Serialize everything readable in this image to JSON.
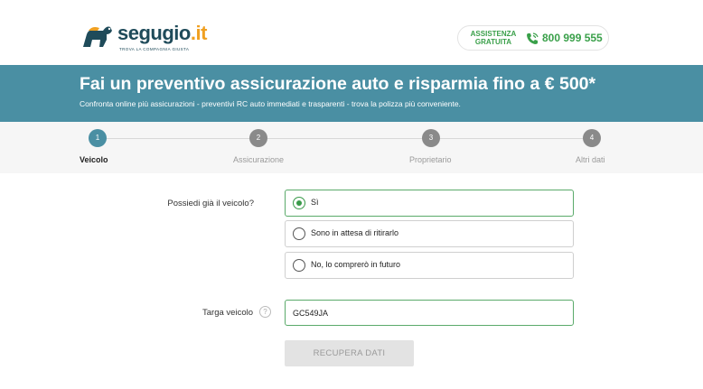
{
  "header": {
    "logo_name": "segugio",
    "logo_tld": ".it",
    "logo_tagline": "TROVA LA COMPAGNIA GIUSTA",
    "assist_line1": "ASSISTENZA",
    "assist_line2": "GRATUITA",
    "phone": "800 999 555"
  },
  "banner": {
    "title": "Fai un preventivo assicurazione auto e risparmia fino a € 500*",
    "subtitle": "Confronta online più assicurazioni - preventivi RC auto immediati e trasparenti - trova la polizza più conveniente."
  },
  "stepper": {
    "steps": [
      {
        "num": "1",
        "label": "Veicolo",
        "active": true
      },
      {
        "num": "2",
        "label": "Assicurazione",
        "active": false
      },
      {
        "num": "3",
        "label": "Proprietario",
        "active": false
      },
      {
        "num": "4",
        "label": "Altri dati",
        "active": false
      }
    ]
  },
  "form": {
    "question": "Possiedi già il veicolo?",
    "options": [
      {
        "label": "Sì",
        "selected": true
      },
      {
        "label": "Sono in attesa di ritirarlo",
        "selected": false
      },
      {
        "label": "No, lo comprerò in futuro",
        "selected": false
      }
    ],
    "targa_label": "Targa veicolo",
    "help_symbol": "?",
    "targa_value": "GC549JA",
    "button_label": "RECUPERA DATI"
  },
  "colors": {
    "brand_teal": "#4a8fa3",
    "brand_green": "#3aa04a",
    "logo_dark": "#1f4b5a",
    "logo_orange": "#f0a021"
  }
}
